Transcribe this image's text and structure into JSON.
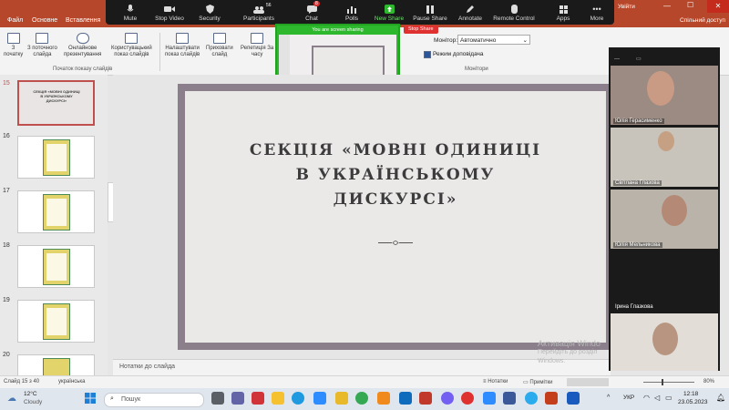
{
  "ppt_tabs": [
    "Файл",
    "Основне",
    "Вставлення"
  ],
  "zoom_toolbar": {
    "mute": "Mute",
    "stop_video": "Stop Video",
    "security": "Security",
    "participants": "Participants",
    "participants_count": "56",
    "chat": "Chat",
    "chat_badge": "8",
    "polls": "Polls",
    "new_share": "New Share",
    "pause_share": "Pause Share",
    "annotate": "Annotate",
    "remote_control": "Remote Control",
    "apps": "Apps",
    "more": "More"
  },
  "sharing_banner": "You are screen sharing",
  "stop_share": "Stop Share",
  "window": {
    "title_fragment": "Увійти",
    "share_access": "Спільний доступ"
  },
  "ribbon": {
    "from_start": "З\nпочатку",
    "from_current": "З поточного\nслайда",
    "online_present": "Онлайнове\nпрезентування",
    "custom_show": "Користувацький\nпоказ слайдів",
    "group_start": "Початок показу слайдів",
    "setup_show": "Налаштувати\nпоказ слайдів",
    "hide_slide": "Приховати\nслайд",
    "rehearse": "Репетиція За\nчасу",
    "monitor_label": "Монітор:",
    "monitor_value": "Автоматично",
    "presenter_view": "Режим доповідача",
    "group_monitors": "Монітори"
  },
  "thumbnails": {
    "numbers": [
      "15",
      "16",
      "17",
      "18",
      "19",
      "20"
    ],
    "selected_text": "СЕКЦІЯ «МОВНІ ОДИНИЦІ В УКРАЇНСЬКОМУ ДИСКУРСІ»",
    "cert_label": "ГРАМОТА"
  },
  "slide": {
    "title_line1": "СЕКЦІЯ «МОВНІ ОДИНИЦІ",
    "title_line2": "В УКРАЇНСЬКОМУ",
    "title_line3": "ДИСКУРСІ»"
  },
  "notes_placeholder": "Нотатки до слайда",
  "participants": [
    {
      "name": "Юлія Герасименко"
    },
    {
      "name": "Світлана Глазова"
    },
    {
      "name": "Юлія Мельникова"
    },
    {
      "name": "Ірина Глазкова"
    },
    {
      "name": ""
    }
  ],
  "statusbar": {
    "slide_info": "Слайд 15 з 40",
    "language": "українська",
    "notes": "Нотатки",
    "comments": "Примітки",
    "zoom": "80%"
  },
  "watermark": {
    "line1": "Активація Windo",
    "line2": "Перейдіть до розділ",
    "line3": "Windows."
  },
  "taskbar": {
    "temperature": "12°C",
    "weather": "Cloudy",
    "search": "Пошук",
    "lang": "УКР",
    "time": "12:18",
    "date": "23.05.2023"
  },
  "colors": {
    "ppt_accent": "#b7472a",
    "zoom_green": "#2db82d",
    "stop_red": "#e03131"
  }
}
